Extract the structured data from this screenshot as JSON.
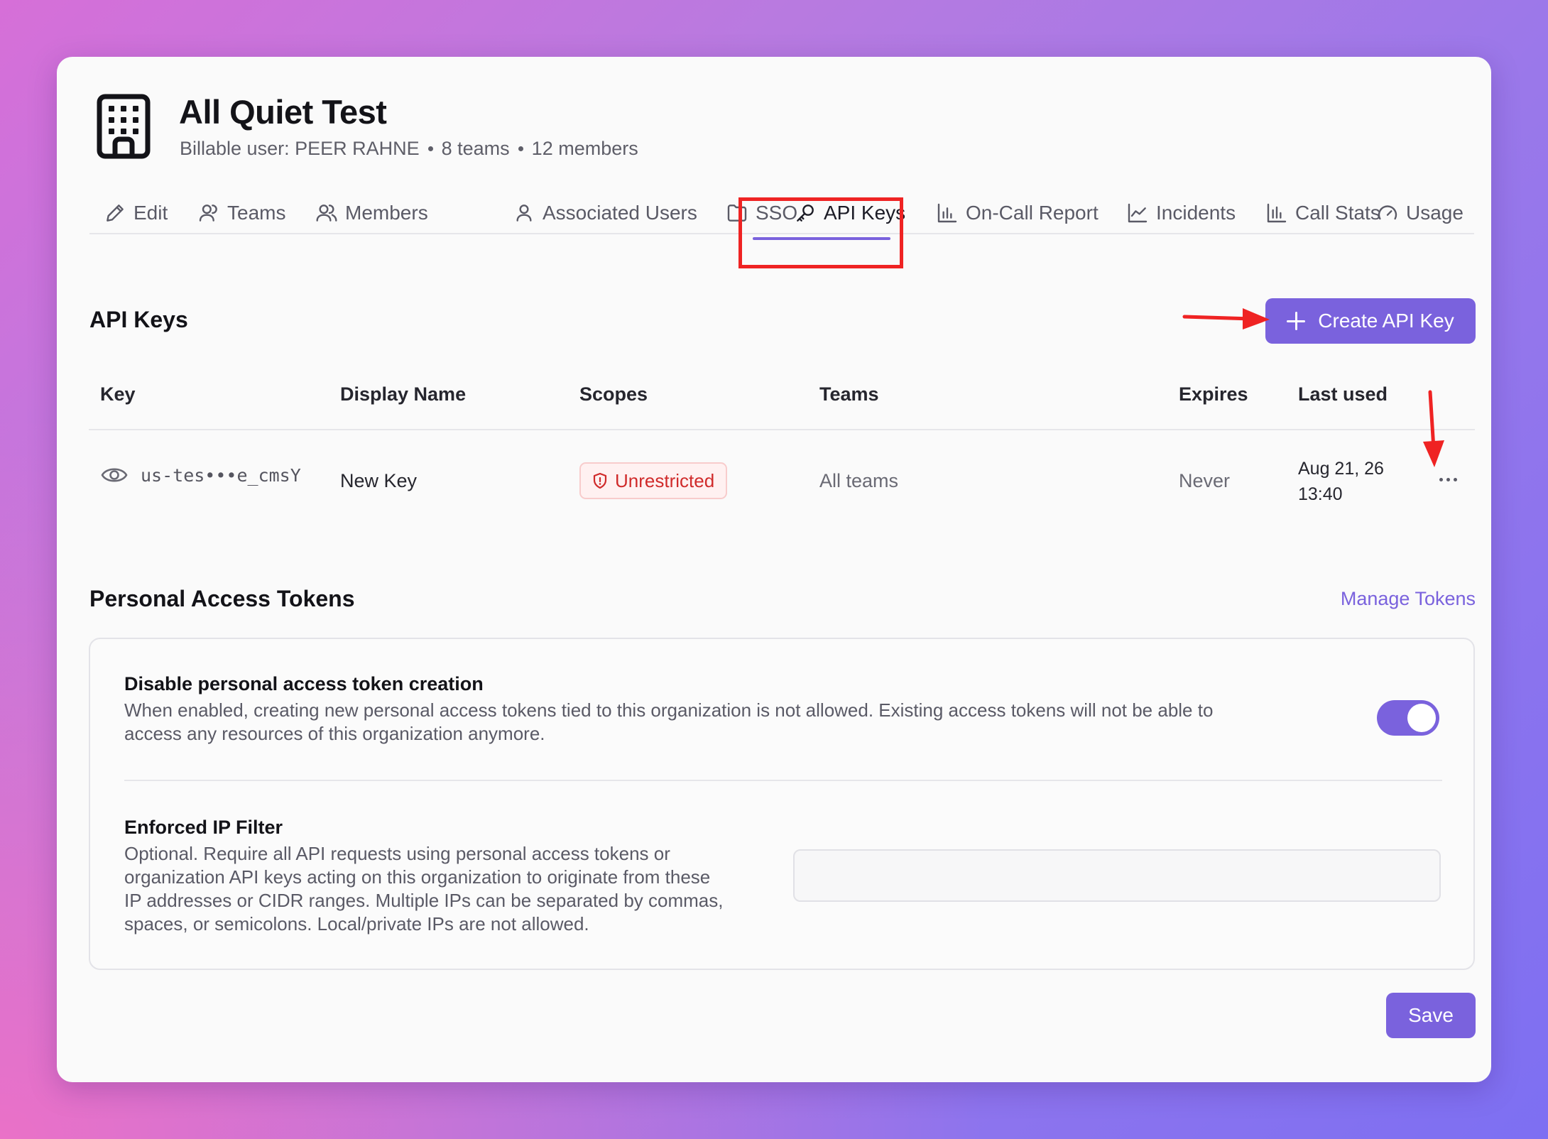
{
  "org": {
    "title": "All Quiet Test",
    "billable_user": "Billable user: PEER RAHNE",
    "teams_count": "8 teams",
    "members_count": "12 members"
  },
  "tabs": [
    {
      "label": "Edit",
      "icon": "pencil-icon"
    },
    {
      "label": "Teams",
      "icon": "user-icon"
    },
    {
      "label": "Members",
      "icon": "users-icon"
    },
    {
      "label": "Associated Users",
      "icon": "user-icon"
    },
    {
      "label": "SSO",
      "icon": "folder-icon"
    },
    {
      "label": "API Keys",
      "icon": "key-icon",
      "active": true
    },
    {
      "label": "On-Call Report",
      "icon": "bar-chart-icon"
    },
    {
      "label": "Incidents",
      "icon": "line-chart-icon"
    },
    {
      "label": "Call Stats",
      "icon": "bar-chart-icon"
    },
    {
      "label": "Usage",
      "icon": "gauge-icon"
    }
  ],
  "api_keys": {
    "title": "API Keys",
    "create_label": "Create API Key",
    "columns": [
      "Key",
      "Display Name",
      "Scopes",
      "Teams",
      "Expires",
      "Last used"
    ],
    "rows": [
      {
        "key": "us-tes•••e_cmsY",
        "display_name": "New Key",
        "scope": "Unrestricted",
        "teams": "All teams",
        "expires": "Never",
        "last_used_date": "Aug 21, 26",
        "last_used_time": "13:40"
      }
    ]
  },
  "pat": {
    "title": "Personal Access Tokens",
    "manage_label": "Manage Tokens",
    "disable_title": "Disable personal access token creation",
    "disable_desc_1": "When enabled, creating new personal access tokens tied to this organization is not allowed. Existing access tokens will not be able to",
    "disable_desc_2": "access any resources of this organization anymore.",
    "disable_enabled": true,
    "ip_title": "Enforced IP Filter",
    "ip_desc_1": "Optional. Require all API requests using personal access tokens or",
    "ip_desc_2": "organization API keys acting on this organization to originate from these",
    "ip_desc_3": "IP addresses or CIDR ranges. Multiple IPs can be separated by commas,",
    "ip_desc_4": "spaces, or semicolons. Local/private IPs are not allowed.",
    "ip_value": ""
  },
  "save_label": "Save",
  "colors": {
    "accent": "#7a62dd",
    "danger": "#d02b2b",
    "annotation": "#ef2323"
  }
}
